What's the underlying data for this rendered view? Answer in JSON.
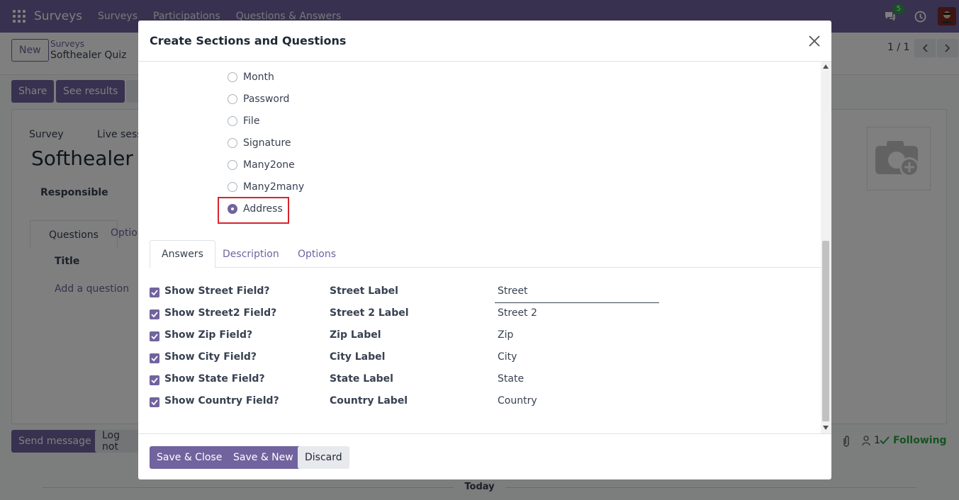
{
  "navbar": {
    "brand": "Surveys",
    "menu": [
      "Surveys",
      "Participations",
      "Questions & Answers"
    ],
    "messages_badge": "5"
  },
  "control_panel": {
    "new_button": "New",
    "breadcrumb_parent": "Surveys",
    "breadcrumb_current": "Softhealer Quiz",
    "pager": "1 / 1"
  },
  "background": {
    "share_button": "Share",
    "see_results_button": "See results",
    "survey_radio": "Survey",
    "live_session_radio": "Live sess",
    "record_title": "Softhealer Q",
    "responsible_label": "Responsible",
    "tab_questions": "Questions",
    "tab_options": "Option",
    "col_title": "Title",
    "add_question": "Add a question",
    "send_message": "Send message",
    "log_note": "Log not",
    "attachments_count": "1",
    "following": "Following",
    "today": "Today"
  },
  "modal": {
    "title": "Create Sections and Questions",
    "question_types": [
      {
        "label": "Month",
        "checked": false
      },
      {
        "label": "Password",
        "checked": false
      },
      {
        "label": "File",
        "checked": false
      },
      {
        "label": "Signature",
        "checked": false
      },
      {
        "label": "Many2one",
        "checked": false
      },
      {
        "label": "Many2many",
        "checked": false
      },
      {
        "label": "Address",
        "checked": true
      }
    ],
    "tabs": [
      "Answers",
      "Description",
      "Options"
    ],
    "active_tab": "Answers",
    "answers": [
      {
        "toggle": "Show Street Field?",
        "label": "Street Label",
        "value": "Street"
      },
      {
        "toggle": "Show Street2 Field?",
        "label": "Street 2 Label",
        "value": "Street 2"
      },
      {
        "toggle": "Show Zip Field?",
        "label": "Zip Label",
        "value": "Zip"
      },
      {
        "toggle": "Show City Field?",
        "label": "City Label",
        "value": "City"
      },
      {
        "toggle": "Show State Field?",
        "label": "State Label",
        "value": "State"
      },
      {
        "toggle": "Show Country Field?",
        "label": "Country Label",
        "value": "Country"
      }
    ],
    "footer": {
      "save_close": "Save & Close",
      "save_new": "Save & New",
      "discard": "Discard"
    }
  },
  "colors": {
    "brand": "#71639e",
    "highlight": "#d9232e",
    "following": "#28a745"
  }
}
